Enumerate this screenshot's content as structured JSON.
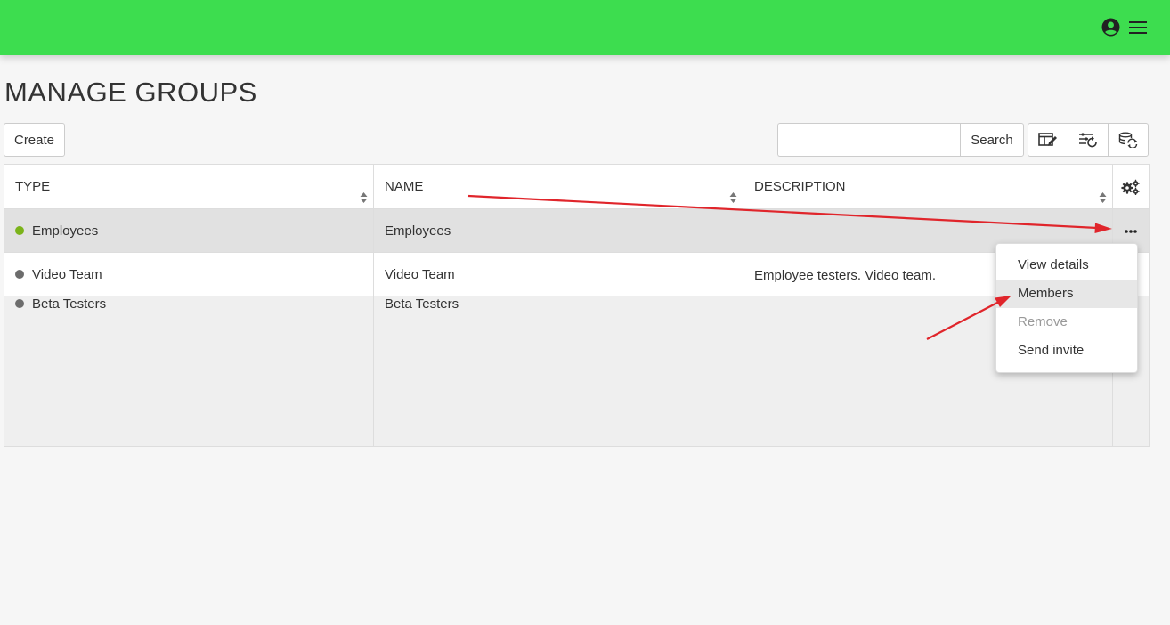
{
  "header": {
    "user_icon": "user-circle-icon",
    "menu_icon": "hamburger-menu-icon",
    "accent_color": "#3ddd4f"
  },
  "page": {
    "title": "MANAGE GROUPS"
  },
  "toolbar": {
    "create_label": "Create",
    "search_value": "",
    "search_label": "Search",
    "icons": [
      "edit-columns-icon",
      "reset-filters-icon",
      "refresh-data-icon"
    ]
  },
  "table": {
    "columns": [
      "TYPE",
      "NAME",
      "DESCRIPTION"
    ],
    "settings_icon": "gears-icon",
    "rows": [
      {
        "type": "Employees",
        "name": "Employees",
        "description": "",
        "dot_color": "#7bb31a"
      },
      {
        "type": "Video Team",
        "name": "Video Team",
        "description": "Employee testers. Video team.",
        "dot_color": "#6c6c6c"
      },
      {
        "type": "Beta Testers",
        "name": "Beta Testers",
        "description": "",
        "dot_color": "#6c6c6c"
      }
    ]
  },
  "context_menu": {
    "items": [
      "View details",
      "Members",
      "Remove",
      "Send invite"
    ]
  }
}
